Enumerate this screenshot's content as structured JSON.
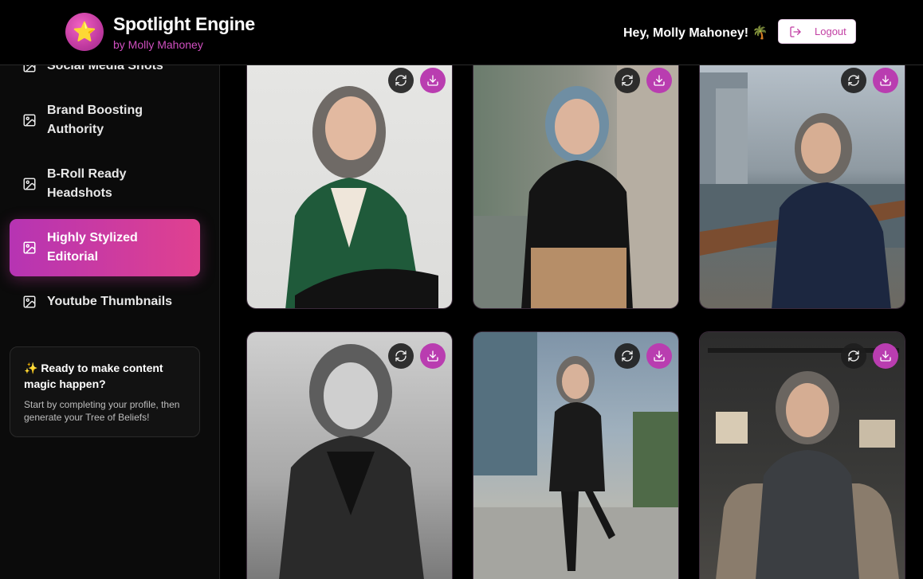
{
  "header": {
    "app_title": "Spotlight Engine",
    "app_subtitle": "by Molly Mahoney",
    "logo_glyph": "⭐",
    "greeting": "Hey, Molly Mahoney! 🌴",
    "logout_label": "Logout"
  },
  "sidebar": {
    "items": [
      {
        "label": "Social Media Shots",
        "icon": "image-icon",
        "active": false
      },
      {
        "label": "Brand Boosting Authority",
        "icon": "image-icon",
        "active": false
      },
      {
        "label": "B-Roll Ready Headshots",
        "icon": "image-icon",
        "active": false
      },
      {
        "label": "Highly Stylized Editorial",
        "icon": "image-icon",
        "active": true
      },
      {
        "label": "Youtube Thumbnails",
        "icon": "image-icon",
        "active": false
      }
    ],
    "promo": {
      "title": "✨ Ready to make content magic happen?",
      "text": "Start by completing your profile, then generate your Tree of Beliefs!"
    }
  },
  "gallery": {
    "images": [
      {
        "subject": "woman in green blazer studio portrait",
        "regenerate_icon": "refresh-icon",
        "download_icon": "download-icon"
      },
      {
        "subject": "woman leaning on brick wall",
        "regenerate_icon": "refresh-icon",
        "download_icon": "download-icon"
      },
      {
        "subject": "woman on balcony with city skyline",
        "regenerate_icon": "refresh-icon",
        "download_icon": "download-icon"
      },
      {
        "subject": "black and white laughing on stairs",
        "regenerate_icon": "refresh-icon",
        "download_icon": "download-icon"
      },
      {
        "subject": "woman in leather jacket on steps",
        "regenerate_icon": "refresh-icon",
        "download_icon": "download-icon"
      },
      {
        "subject": "woman seated in armchair with bookshelf",
        "regenerate_icon": "refresh-icon",
        "download_icon": "download-icon"
      }
    ]
  },
  "colors": {
    "accent": "#c23fa3",
    "active_gradient_start": "#b634b3",
    "active_gradient_end": "#e0418f"
  }
}
